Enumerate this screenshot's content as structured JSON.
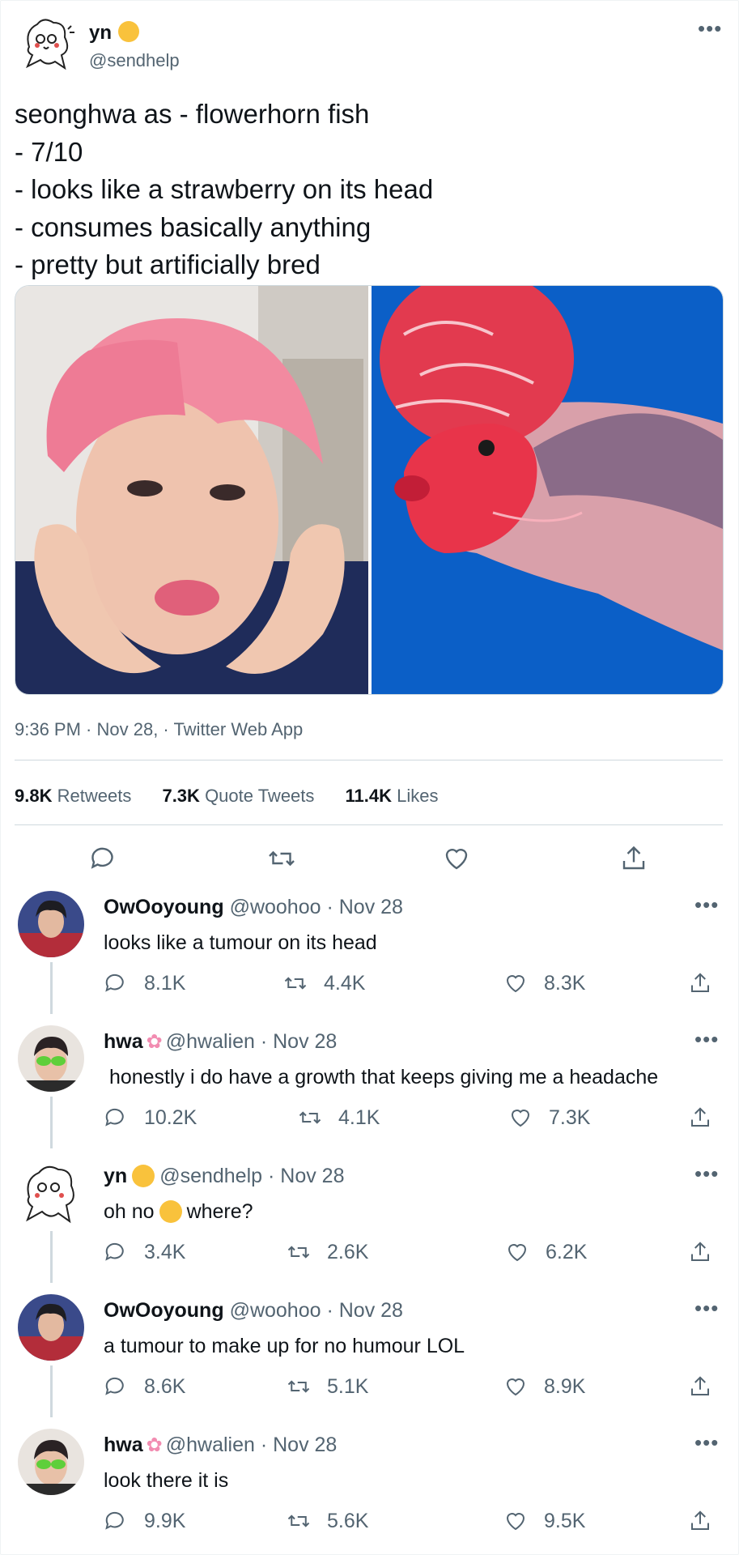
{
  "tweet": {
    "display_name": "yn",
    "handle": "@sendhelp",
    "text": "seonghwa as - flowerhorn fish\n- 7/10\n- looks like a strawberry on its head\n- consumes basically anything\n- pretty but artificially bred",
    "time": "9:36 PM · Nov 28, · Twitter Web App",
    "stats": {
      "retweets_count": "9.8K",
      "retweets_label": "Retweets",
      "quotes_count": "7.3K",
      "quotes_label": "Quote Tweets",
      "likes_count": "11.4K",
      "likes_label": "Likes"
    },
    "images": [
      {
        "icon": "person-photo",
        "desc_color": "#f4a0b5"
      },
      {
        "icon": "flowerhorn-fish-photo",
        "desc_color": "#0b5fc7"
      }
    ]
  },
  "replies": [
    {
      "name": "OwOoyoung",
      "handle": "@woohoo · Nov 28",
      "text": "looks like a tumour on its head",
      "replies": "8.1K",
      "retweets": "4.4K",
      "likes": "8.3K",
      "avatar": "red-shirt-avatar"
    },
    {
      "name": "hwa",
      "handle": "@hwalien · Nov 28",
      "text": " honestly i do have a growth that keeps giving me a headache",
      "replies": "10.2K",
      "retweets": "4.1K",
      "likes": "7.3K",
      "avatar": "alien-glasses-avatar"
    },
    {
      "name": "yn",
      "handle": "@sendhelp · Nov 28",
      "text_before": "oh no",
      "text_after": "where?",
      "replies": "3.4K",
      "retweets": "2.6K",
      "likes": "6.2K",
      "avatar": "doodle-avatar"
    },
    {
      "name": "OwOoyoung",
      "handle": "@woohoo · Nov 28",
      "text": "a tumour to make up for no humour LOL",
      "replies": "8.6K",
      "retweets": "5.1K",
      "likes": "8.9K",
      "avatar": "red-shirt-avatar"
    },
    {
      "name": "hwa",
      "handle": "@hwalien · Nov 28",
      "text": "look there it is",
      "replies": "9.9K",
      "retweets": "5.6K",
      "likes": "9.5K",
      "avatar": "alien-glasses-avatar"
    }
  ],
  "colors": {
    "text": "#0f1419",
    "muted": "#536471",
    "border": "#cfd9de",
    "emoji": "#f9c23c"
  }
}
